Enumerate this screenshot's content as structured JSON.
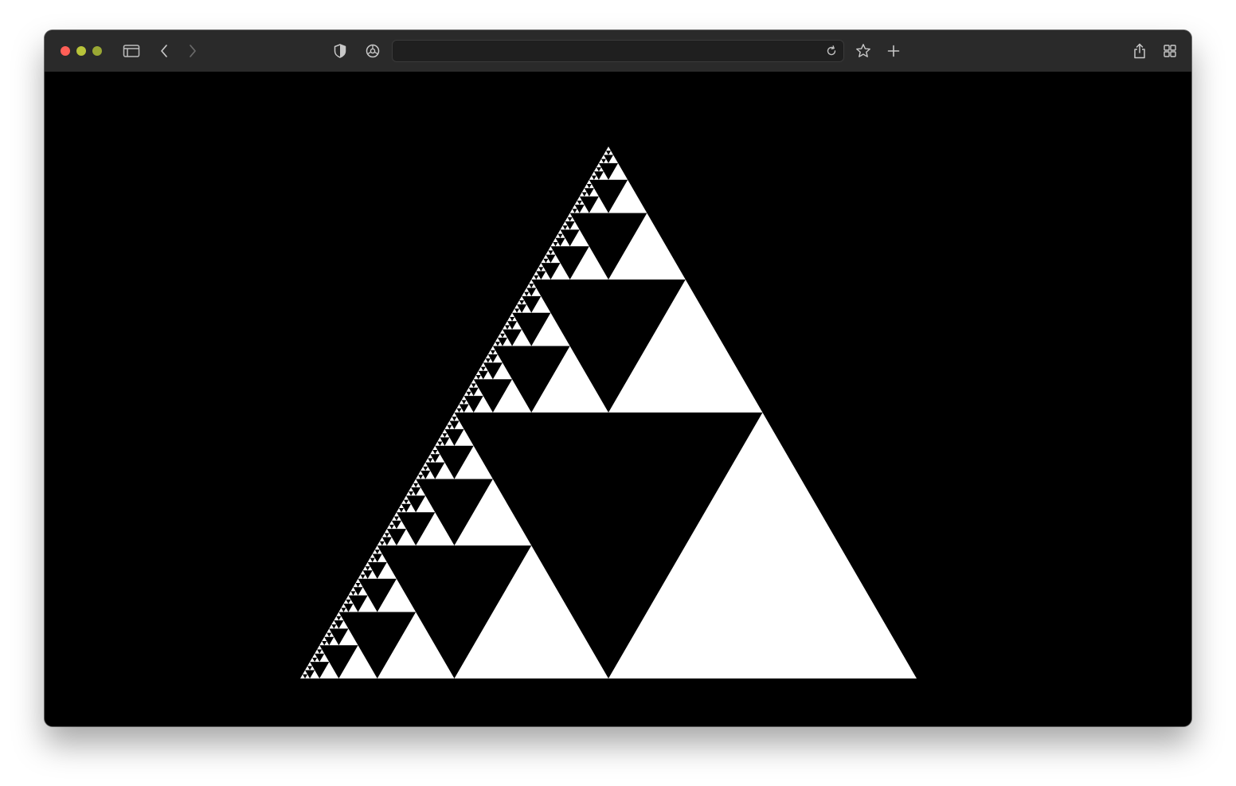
{
  "window": {
    "traffic_lights": {
      "close_color": "#ff5f57",
      "minimize_color": "#b8c43a",
      "zoom_color": "#9aa834"
    }
  },
  "toolbar": {
    "icons": [
      "sidebar-icon",
      "back-chevron-icon",
      "forward-chevron-icon",
      "privacy-shield-icon",
      "settings-gear-icon",
      "reload-icon",
      "bookmark-star-icon",
      "new-tab-plus-icon",
      "share-icon",
      "tab-overview-icon"
    ],
    "address": {
      "value": "",
      "placeholder": ""
    }
  },
  "page": {
    "background_color": "#000000",
    "fractal": {
      "kind": "sierpinski-triangle",
      "fill_color": "#ffffff",
      "recursion_depth": 7
    }
  }
}
